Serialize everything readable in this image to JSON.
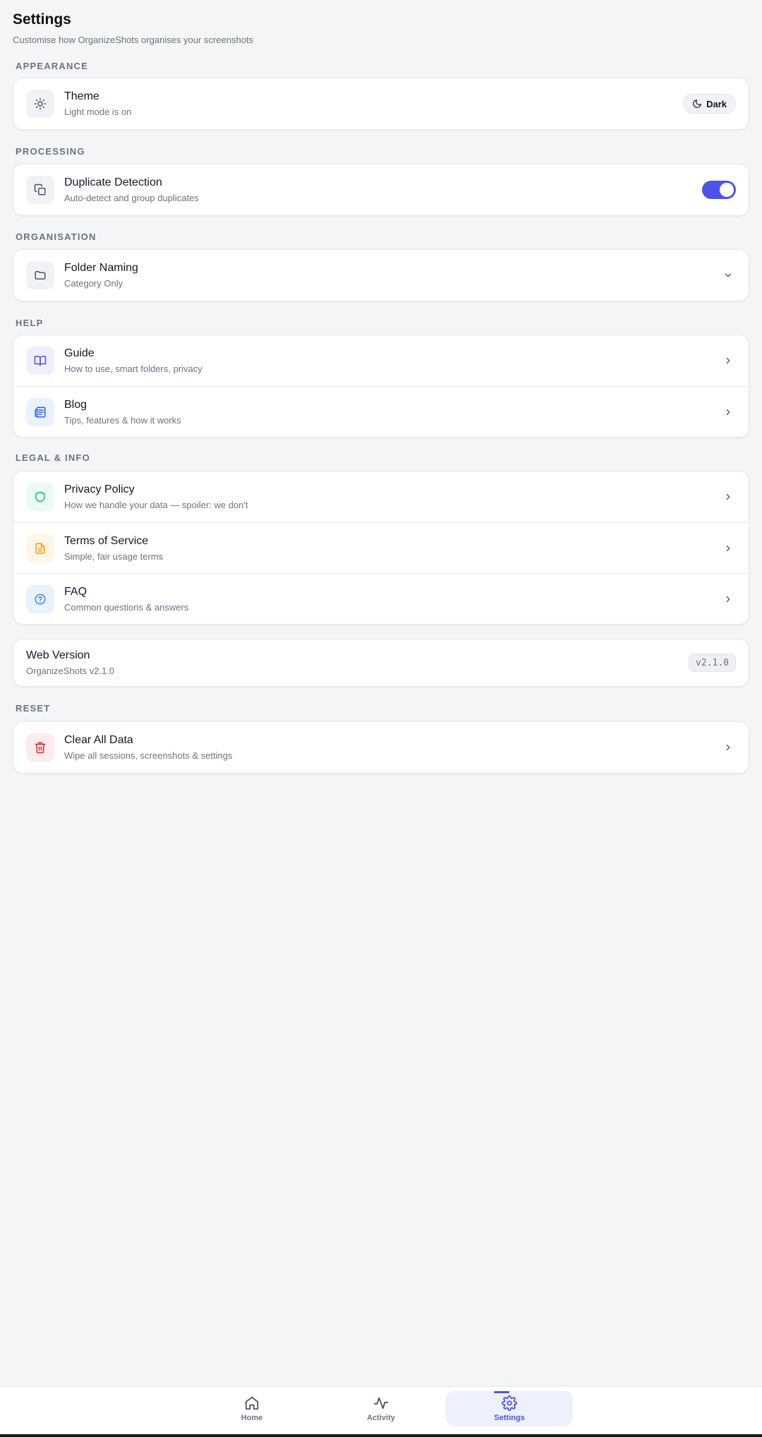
{
  "header": {
    "title": "Settings",
    "subtitle": "Customise how OrganizeShots organises your screenshots"
  },
  "sections": {
    "appearance": "APPEARANCE",
    "processing": "PROCESSING",
    "organisation": "ORGANISATION",
    "help": "HELP",
    "legal": "LEGAL & INFO",
    "reset": "RESET"
  },
  "theme": {
    "title": "Theme",
    "subtitle": "Light mode is on",
    "button_label": "Dark",
    "icon": "sun-icon"
  },
  "duplicate": {
    "title": "Duplicate Detection",
    "subtitle": "Auto-detect and group duplicates",
    "enabled": true,
    "icon": "copy-icon"
  },
  "folder_naming": {
    "title": "Folder Naming",
    "selected": "Category Only",
    "icon": "folder-icon"
  },
  "help": {
    "items": [
      {
        "title": "Guide",
        "subtitle": "How to use, smart folders, privacy",
        "icon": "book-icon"
      },
      {
        "title": "Blog",
        "subtitle": "Tips, features & how it works",
        "icon": "newspaper-icon"
      }
    ]
  },
  "legal": {
    "items": [
      {
        "title": "Privacy Policy",
        "subtitle": "How we handle your data — spoiler: we don't",
        "icon": "shield-icon"
      },
      {
        "title": "Terms of Service",
        "subtitle": "Simple, fair usage terms",
        "icon": "document-icon"
      },
      {
        "title": "FAQ",
        "subtitle": "Common questions & answers",
        "icon": "help-circle-icon"
      }
    ]
  },
  "version": {
    "title": "Web Version",
    "subtitle": "OrganizeShots v2.1.0",
    "badge": "v2.1.0"
  },
  "reset": {
    "title": "Clear All Data",
    "subtitle": "Wipe all sessions, screenshots & settings",
    "icon": "trash-icon"
  },
  "nav": {
    "items": [
      {
        "label": "Home",
        "icon": "home-icon"
      },
      {
        "label": "Activity",
        "icon": "activity-icon"
      },
      {
        "label": "Settings",
        "icon": "gear-icon"
      }
    ],
    "active": "Settings"
  },
  "colors": {
    "accent": "#4f52e8",
    "background": "#f4f5f7",
    "danger": "#dc2626",
    "success": "#10b981",
    "warning": "#f59e0b",
    "info": "#3b82f6"
  }
}
